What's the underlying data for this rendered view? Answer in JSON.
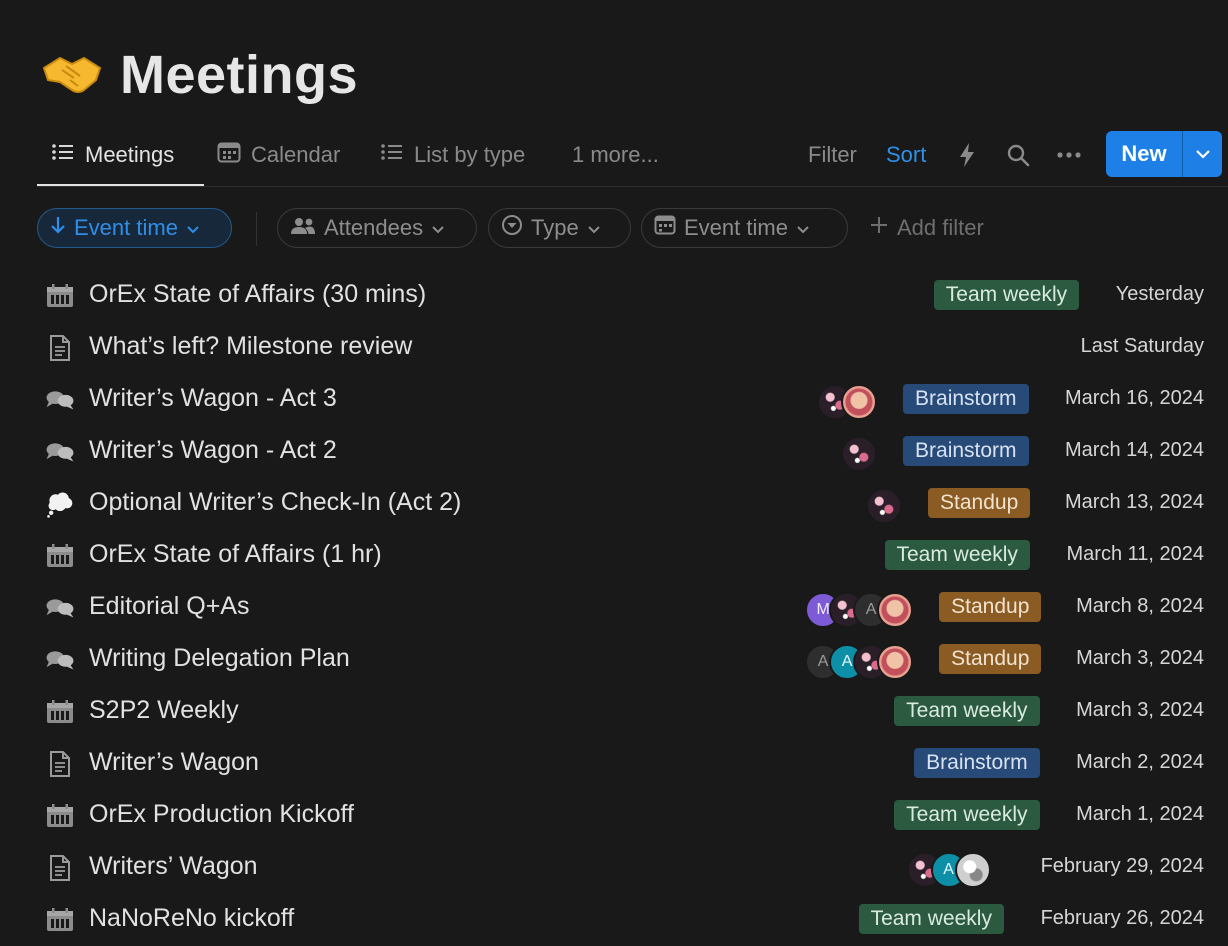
{
  "page": {
    "title": "Meetings",
    "emoji": "🤝"
  },
  "tabs": [
    {
      "label": "Meetings",
      "icon": "list-icon",
      "active": true
    },
    {
      "label": "Calendar",
      "icon": "calendar-icon",
      "active": false
    },
    {
      "label": "List by type",
      "icon": "list-icon",
      "active": false
    },
    {
      "label": "1 more...",
      "icon": "",
      "active": false
    }
  ],
  "toolbar": {
    "filter": "Filter",
    "sort": "Sort",
    "new": "New"
  },
  "filters": {
    "sort_pill": "Event time",
    "attendees": "Attendees",
    "type": "Type",
    "event_time": "Event time",
    "add_filter": "Add filter"
  },
  "colors": {
    "accent": "#2f8ee8",
    "new_button": "#1e80e6",
    "tag_team_weekly": "#2b5a41",
    "tag_brainstorm": "#284a78",
    "tag_standup": "#8a5c23"
  },
  "rows": [
    {
      "title": "OrEx State of Affairs (30 mins)",
      "icon": "calendar-grid-icon",
      "tag": "Team weekly",
      "date": "Yesterday",
      "avatars": []
    },
    {
      "title": "What’s left? Milestone review",
      "icon": "document-icon",
      "tag": "",
      "date": "Last Saturday",
      "avatars": []
    },
    {
      "title": "Writer’s Wagon - Act 3",
      "icon": "chat-bubbles-icon",
      "tag": "Brainstorm",
      "date": "March 16, 2024",
      "avatars": [
        "photo1",
        "photo2"
      ]
    },
    {
      "title": "Writer’s Wagon - Act 2",
      "icon": "chat-bubbles-icon",
      "tag": "Brainstorm",
      "date": "March 14, 2024",
      "avatars": [
        "photo1"
      ]
    },
    {
      "title": "Optional Writer’s Check-In (Act 2)",
      "icon": "thought-bubble-icon",
      "tag": "Standup",
      "date": "March 13, 2024",
      "avatars": [
        "photo1"
      ]
    },
    {
      "title": "OrEx State of Affairs (1 hr)",
      "icon": "calendar-grid-icon",
      "tag": "Team weekly",
      "date": "March 11, 2024",
      "avatars": []
    },
    {
      "title": "Editorial Q+As",
      "icon": "chat-bubbles-icon",
      "tag": "Standup",
      "date": "March 8, 2024",
      "avatars": [
        "M",
        "photo1",
        "A",
        "photo2"
      ]
    },
    {
      "title": "Writing Delegation Plan",
      "icon": "chat-bubbles-icon",
      "tag": "Standup",
      "date": "March 3, 2024",
      "avatars": [
        "A",
        "A-teal",
        "photo1",
        "photo2"
      ]
    },
    {
      "title": "S2P2 Weekly",
      "icon": "calendar-grid-icon",
      "tag": "Team weekly",
      "date": "March 3, 2024",
      "avatars": []
    },
    {
      "title": "Writer’s Wagon",
      "icon": "document-icon",
      "tag": "Brainstorm",
      "date": "March 2, 2024",
      "avatars": []
    },
    {
      "title": "OrEx Production Kickoff",
      "icon": "calendar-grid-icon",
      "tag": "Team weekly",
      "date": "March 1, 2024",
      "avatars": []
    },
    {
      "title": "Writers’ Wagon",
      "icon": "document-icon",
      "tag": "",
      "date": "February 29, 2024",
      "avatars": [
        "photo1",
        "A-teal",
        "photo3"
      ]
    },
    {
      "title": "NaNoReNo kickoff",
      "icon": "calendar-grid-icon",
      "tag": "Team weekly",
      "date": "February 26, 2024",
      "avatars": []
    }
  ]
}
